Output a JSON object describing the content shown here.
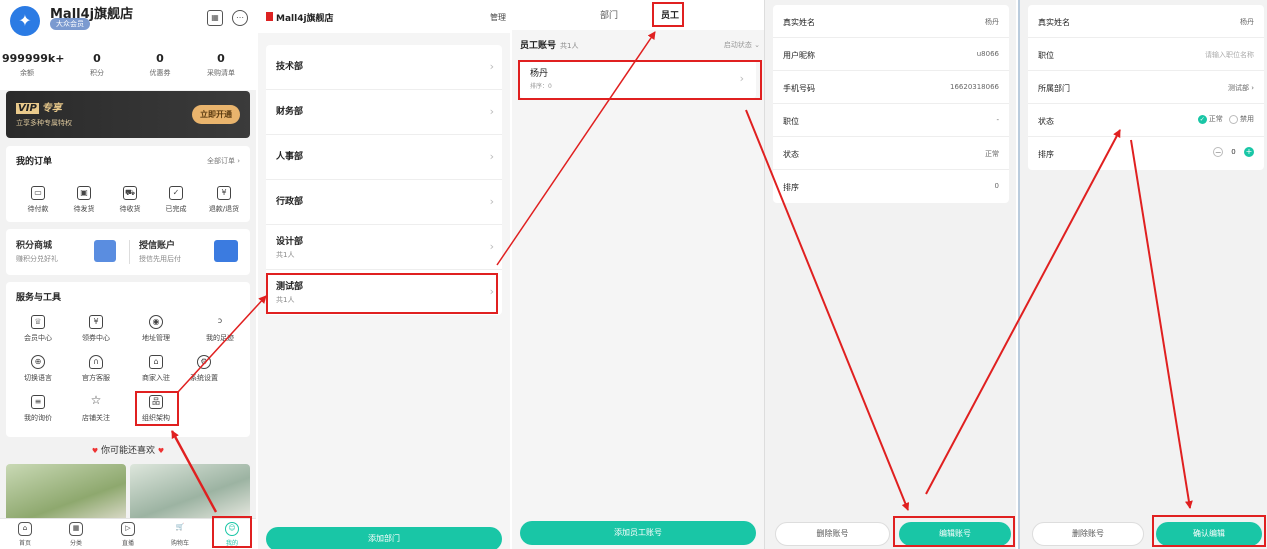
{
  "p1": {
    "shop_name": "Mall4j旗舰店",
    "member_badge": "大众会员",
    "stats": [
      {
        "value": "999999k+",
        "label": "余额"
      },
      {
        "value": "0",
        "label": "积分"
      },
      {
        "value": "0",
        "label": "优惠券"
      },
      {
        "value": "0",
        "label": "采购清单"
      }
    ],
    "vip": {
      "title": "专享",
      "subtitle": "立享多种专属特权",
      "button": "立即开通"
    },
    "orders": {
      "title": "我的订单",
      "more": "全部订单",
      "items": [
        "待付款",
        "待发货",
        "待收货",
        "已完成",
        "退款/退货"
      ]
    },
    "links": {
      "points": "积分商城",
      "points_sub": "赚积分兑好礼",
      "credit": "授信账户",
      "credit_sub": "授信先用后付"
    },
    "services": {
      "title": "服务与工具",
      "items": [
        "会员中心",
        "领券中心",
        "地址管理",
        "我的足迹",
        "切换语言",
        "官方客服",
        "商家入驻",
        "系统设置",
        "我的询价",
        "店铺关注",
        "组织架构"
      ]
    },
    "recommend": "你可能还喜欢",
    "tabbar": [
      "首页",
      "分类",
      "直播",
      "购物车",
      "我的"
    ]
  },
  "p2": {
    "title": "Mall4j旗舰店",
    "manage": "管理",
    "depts": [
      {
        "name": "技术部",
        "count": ""
      },
      {
        "name": "财务部",
        "count": ""
      },
      {
        "name": "人事部",
        "count": ""
      },
      {
        "name": "行政部",
        "count": ""
      },
      {
        "name": "设计部",
        "count": "共1人"
      },
      {
        "name": "测试部",
        "count": "共1人"
      }
    ],
    "add_button": "添加部门"
  },
  "p3": {
    "tabs": [
      "部门",
      "员工"
    ],
    "section": "员工账号",
    "count": "共1人",
    "filter": "启动状态",
    "employee": {
      "name": "杨丹",
      "sort": "排序：0"
    },
    "add_button": "添加员工账号"
  },
  "p4": {
    "rows": [
      {
        "k": "真实姓名",
        "v": "杨丹"
      },
      {
        "k": "用户昵称",
        "v": "u8066"
      },
      {
        "k": "手机号码",
        "v": "16620318066"
      },
      {
        "k": "职位",
        "v": "-"
      },
      {
        "k": "状态",
        "v": "正常"
      },
      {
        "k": "排序",
        "v": "0"
      }
    ],
    "delete_button": "删除账号",
    "edit_button": "编辑账号"
  },
  "p5": {
    "name_k": "真实姓名",
    "name_v": "杨丹",
    "pos_k": "职位",
    "pos_placeholder": "请输入职位名称",
    "dept_k": "所属部门",
    "dept_v": "测试部",
    "status_k": "状态",
    "status_on": "正常",
    "status_off": "禁用",
    "sort_k": "排序",
    "sort_v": "0",
    "delete_button": "删除账号",
    "confirm_button": "确认编辑"
  },
  "colors": {
    "accent": "#19c6a6",
    "highlight": "#e02020",
    "vip_gold": "#e9b46d"
  }
}
